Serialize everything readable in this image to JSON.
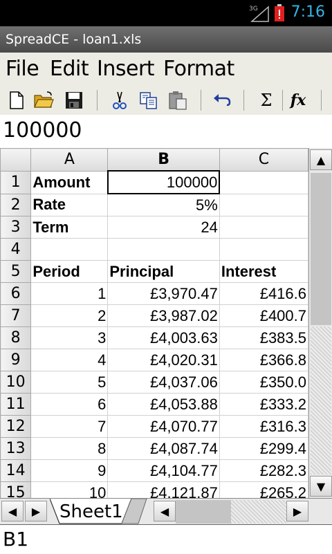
{
  "status_bar": {
    "time": "7:16",
    "network": "3G"
  },
  "app": {
    "title": "SpreadCE - loan1.xls"
  },
  "menu": [
    "File",
    "Edit",
    "Insert",
    "Format"
  ],
  "toolbar": [
    {
      "icon": "new-document-icon"
    },
    {
      "icon": "open-folder-icon"
    },
    {
      "icon": "save-icon"
    },
    {
      "icon": "cut-icon"
    },
    {
      "icon": "copy-icon"
    },
    {
      "icon": "paste-icon"
    },
    {
      "icon": "undo-icon"
    },
    {
      "icon": "sum-icon",
      "glyph": "Σ"
    },
    {
      "icon": "function-icon",
      "glyph": "fx"
    }
  ],
  "formula_bar": {
    "value": "100000"
  },
  "grid": {
    "columns": [
      "A",
      "B",
      "C"
    ],
    "selected_column": "B",
    "selected_cell": "B1",
    "rows": [
      {
        "n": "1",
        "a": "Amount",
        "b": "100000",
        "c": ""
      },
      {
        "n": "2",
        "a": "Rate",
        "b": "5%",
        "c": ""
      },
      {
        "n": "3",
        "a": "Term",
        "b": "24",
        "c": ""
      },
      {
        "n": "4",
        "a": "",
        "b": "",
        "c": ""
      },
      {
        "n": "5",
        "a": "Period",
        "b": "Principal",
        "c": "Interest"
      },
      {
        "n": "6",
        "a": "1",
        "b": "£3,970.47",
        "c": "£416.6"
      },
      {
        "n": "7",
        "a": "2",
        "b": "£3,987.02",
        "c": "£400.7"
      },
      {
        "n": "8",
        "a": "3",
        "b": "£4,003.63",
        "c": "£383.5"
      },
      {
        "n": "9",
        "a": "4",
        "b": "£4,020.31",
        "c": "£366.8"
      },
      {
        "n": "10",
        "a": "5",
        "b": "£4,037.06",
        "c": "£350.0"
      },
      {
        "n": "11",
        "a": "6",
        "b": "£4,053.88",
        "c": "£333.2"
      },
      {
        "n": "12",
        "a": "7",
        "b": "£4,070.77",
        "c": "£316.3"
      },
      {
        "n": "13",
        "a": "8",
        "b": "£4,087.74",
        "c": "£299.4"
      },
      {
        "n": "14",
        "a": "9",
        "b": "£4,104.77",
        "c": "£282.3"
      },
      {
        "n": "15",
        "a": "10",
        "b": "£4,121.87",
        "c": "£265.2"
      }
    ]
  },
  "sheets": [
    "Sheet1"
  ],
  "cell_reference": "B1"
}
